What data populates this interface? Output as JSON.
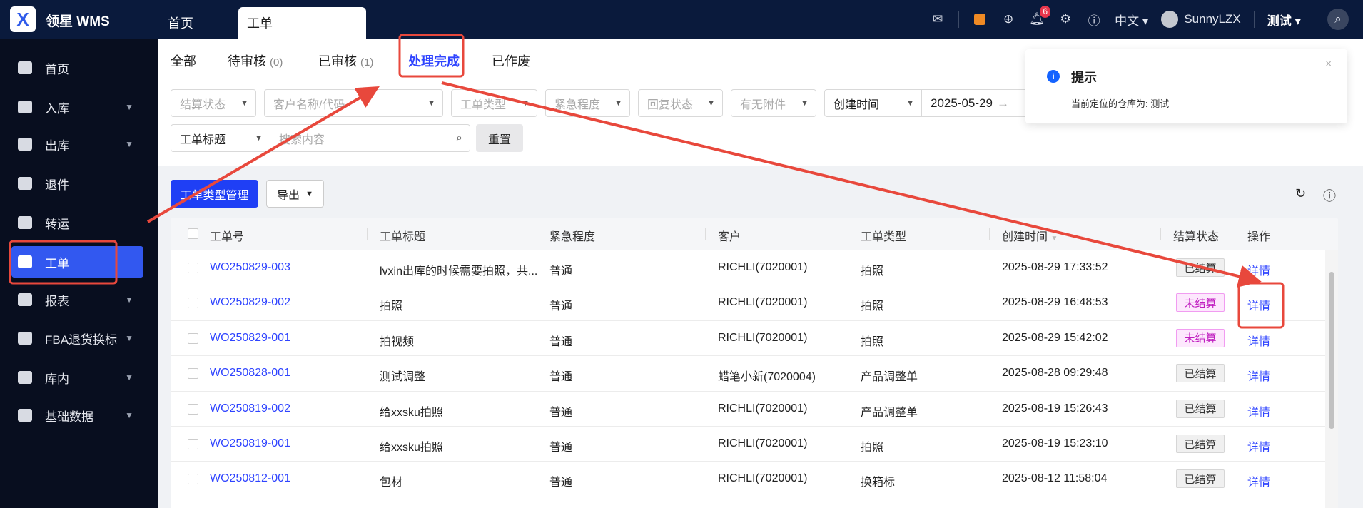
{
  "header": {
    "brand": "领星 WMS",
    "tabs": [
      {
        "label": "首页"
      },
      {
        "label": "工单"
      }
    ],
    "notification_count": "6",
    "language": "中文",
    "user": "SunnyLZX",
    "warehouse": "测试"
  },
  "sidebar": {
    "items": [
      {
        "label": "首页"
      },
      {
        "label": "入库"
      },
      {
        "label": "出库"
      },
      {
        "label": "退件"
      },
      {
        "label": "转运"
      },
      {
        "label": "工单"
      },
      {
        "label": "报表"
      },
      {
        "label": "FBA退货换标"
      },
      {
        "label": "库内"
      },
      {
        "label": "基础数据"
      }
    ]
  },
  "subtabs": [
    {
      "label": "全部",
      "count": ""
    },
    {
      "label": "待审核",
      "count": "(0)"
    },
    {
      "label": "已审核",
      "count": "(1)"
    },
    {
      "label": "处理完成",
      "count": ""
    },
    {
      "label": "已作废",
      "count": ""
    }
  ],
  "filters": {
    "settle": "结算状态",
    "customer": "客户名称/代码",
    "type": "工单类型",
    "urgency": "紧急程度",
    "reply": "回复状态",
    "attach": "有无附件",
    "time_field": "创建时间",
    "date_start": "2025-05-29",
    "search_field": "工单标题",
    "search_placeholder": "搜索内容",
    "reset": "重置"
  },
  "toolbar": {
    "type_manage": "工单类型管理",
    "export": "导出"
  },
  "table": {
    "columns": [
      "工单号",
      "工单标题",
      "紧急程度",
      "客户",
      "工单类型",
      "创建时间",
      "结算状态",
      "操作"
    ],
    "rows": [
      {
        "no": "WO250829-003",
        "title": "lvxin出库的时候需要拍照，共...",
        "urgency": "普通",
        "customer": "RICHLI(7020001)",
        "type": "拍照",
        "time": "2025-08-29 17:33:52",
        "settle": "已结算",
        "action": "详情"
      },
      {
        "no": "WO250829-002",
        "title": "拍照",
        "urgency": "普通",
        "customer": "RICHLI(7020001)",
        "type": "拍照",
        "time": "2025-08-29 16:48:53",
        "settle": "未结算",
        "action": "详情"
      },
      {
        "no": "WO250829-001",
        "title": "拍视频",
        "urgency": "普通",
        "customer": "RICHLI(7020001)",
        "type": "拍照",
        "time": "2025-08-29 15:42:02",
        "settle": "未结算",
        "action": "详情"
      },
      {
        "no": "WO250828-001",
        "title": "测试调整",
        "urgency": "普通",
        "customer": "蜡笔小新(7020004)",
        "type": "产品调整单",
        "time": "2025-08-28 09:29:48",
        "settle": "已结算",
        "action": "详情"
      },
      {
        "no": "WO250819-002",
        "title": "给xxsku拍照",
        "urgency": "普通",
        "customer": "RICHLI(7020001)",
        "type": "产品调整单",
        "time": "2025-08-19 15:26:43",
        "settle": "已结算",
        "action": "详情"
      },
      {
        "no": "WO250819-001",
        "title": "给xxsku拍照",
        "urgency": "普通",
        "customer": "RICHLI(7020001)",
        "type": "拍照",
        "time": "2025-08-19 15:23:10",
        "settle": "已结算",
        "action": "详情"
      },
      {
        "no": "WO250812-001",
        "title": "包材",
        "urgency": "普通",
        "customer": "RICHLI(7020001)",
        "type": "换箱标",
        "time": "2025-08-12 11:58:04",
        "settle": "已结算",
        "action": "详情"
      }
    ]
  },
  "toast": {
    "title": "提示",
    "message": "当前定位的仓库为: 测试"
  },
  "colors": {
    "primary": "#2f44ff",
    "sidebar_active": "#3258f0",
    "header": "#0a1a3c",
    "annotation": "#e8483c"
  }
}
